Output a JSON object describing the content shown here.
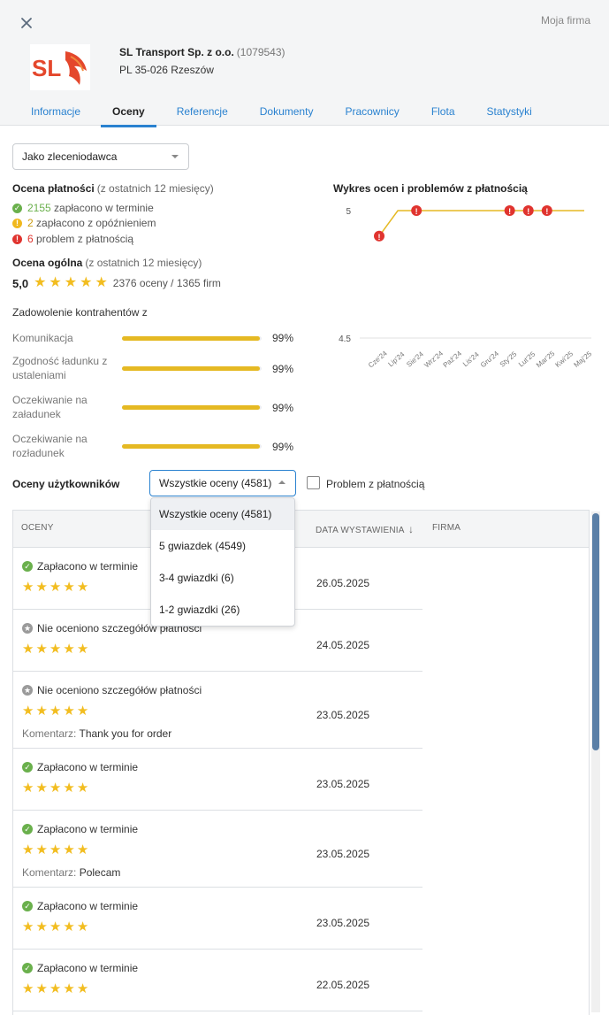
{
  "header": {
    "moja_firma": "Moja firma",
    "company_name": "SL Transport Sp. z o.o.",
    "company_id": "(1079543)",
    "address": "PL 35-026 Rzeszów",
    "logo_text": "SL",
    "tabs": [
      {
        "label": "Informacje",
        "active": false
      },
      {
        "label": "Oceny",
        "active": true
      },
      {
        "label": "Referencje",
        "active": false
      },
      {
        "label": "Dokumenty",
        "active": false
      },
      {
        "label": "Pracownicy",
        "active": false
      },
      {
        "label": "Flota",
        "active": false
      },
      {
        "label": "Statystyki",
        "active": false
      }
    ]
  },
  "role_select": {
    "value": "Jako zleceniodawca"
  },
  "payment": {
    "title": "Ocena płatności",
    "subtitle": "(z ostatnich 12 miesięcy)",
    "on_time_count": "2155",
    "on_time_label": "zapłacono w terminie",
    "late_count": "2",
    "late_label": "zapłacono z opóźnieniem",
    "problem_count": "6",
    "problem_label": "problem z płatnością"
  },
  "overall": {
    "title": "Ocena ogólna",
    "subtitle": "(z ostatnich 12 miesięcy)",
    "score": "5,0",
    "stars": 5,
    "summary": "2376 oceny / 1365 firm"
  },
  "satisfaction": {
    "title": "Zadowolenie kontrahentów z",
    "metrics": [
      {
        "label": "Komunikacja",
        "percent": 99,
        "text": "99%"
      },
      {
        "label": "Zgodność ładunku z ustaleniami",
        "percent": 99,
        "text": "99%"
      },
      {
        "label": "Oczekiwanie na załadunek",
        "percent": 99,
        "text": "99%"
      },
      {
        "label": "Oczekiwanie na rozładunek",
        "percent": 99,
        "text": "99%"
      }
    ]
  },
  "chart_data": {
    "type": "line",
    "title": "Wykres ocen i problemów z płatnością",
    "categories": [
      "Cze'24",
      "Lip'24",
      "Sie'24",
      "Wrz'24",
      "Paź'24",
      "Lis'24",
      "Gru'24",
      "Sty'25",
      "Lut'25",
      "Mar'25",
      "Kwi'25",
      "Maj'25"
    ],
    "values": [
      4.9,
      5.0,
      5.0,
      5.0,
      5.0,
      5.0,
      5.0,
      5.0,
      5.0,
      5.0,
      5.0,
      5.0
    ],
    "problem_markers": [
      0,
      2,
      7,
      8,
      9
    ],
    "ylim": [
      4.5,
      5
    ],
    "yticks": [
      "5",
      "4.5"
    ],
    "line_color": "#e5b923",
    "marker_color": "#e0342f"
  },
  "users": {
    "title": "Oceny użytkowników",
    "filter_value": "Wszystkie oceny (4581)",
    "checkbox_label": "Problem z płatnością",
    "dropdown_options": [
      {
        "label": "Wszystkie oceny (4581)",
        "selected": true
      },
      {
        "label": "5 gwiazdek (4549)",
        "selected": false
      },
      {
        "label": "3-4 gwiazdki (6)",
        "selected": false
      },
      {
        "label": "1-2 gwiazdki (26)",
        "selected": false
      }
    ]
  },
  "table": {
    "headers": {
      "ratings": "OCENY",
      "date": "DATA WYSTAWIENIA",
      "company": "FIRMA"
    },
    "rows": [
      {
        "status": "paid",
        "status_text": "Zapłacono w terminie",
        "stars": 5,
        "date": "26.05.2025",
        "comment": ""
      },
      {
        "status": "none",
        "status_text": "Nie oceniono szczegółów płatności",
        "stars": 5,
        "date": "24.05.2025",
        "comment": ""
      },
      {
        "status": "none",
        "status_text": "Nie oceniono szczegółów płatności",
        "stars": 5,
        "date": "23.05.2025",
        "comment": "Thank you for order"
      },
      {
        "status": "paid",
        "status_text": "Zapłacono w terminie",
        "stars": 5,
        "date": "23.05.2025",
        "comment": ""
      },
      {
        "status": "paid",
        "status_text": "Zapłacono w terminie",
        "stars": 5,
        "date": "23.05.2025",
        "comment": "Polecam"
      },
      {
        "status": "paid",
        "status_text": "Zapłacono w terminie",
        "stars": 5,
        "date": "23.05.2025",
        "comment": ""
      },
      {
        "status": "paid",
        "status_text": "Zapłacono w terminie",
        "stars": 5,
        "date": "22.05.2025",
        "comment": ""
      }
    ],
    "comment_key": "Komentarz:"
  }
}
